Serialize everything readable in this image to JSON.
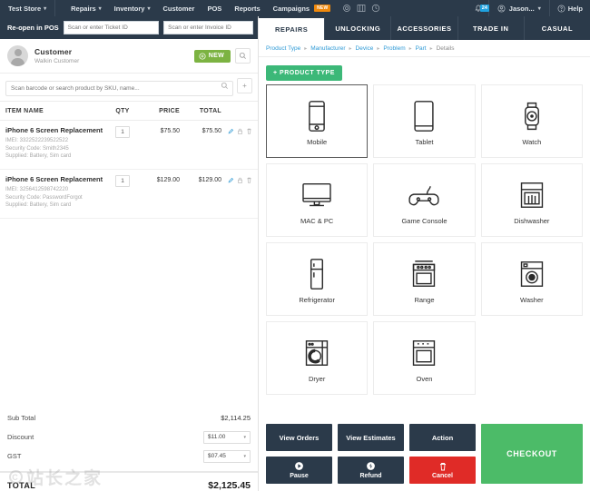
{
  "topnav": {
    "store": "Test Store",
    "items": [
      {
        "label": "Repairs",
        "caret": true,
        "badge": null
      },
      {
        "label": "Inventory",
        "caret": true,
        "badge": null
      },
      {
        "label": "Customer",
        "caret": false,
        "badge": null
      },
      {
        "label": "POS",
        "caret": false,
        "badge": null
      },
      {
        "label": "Reports",
        "caret": false,
        "badge": null
      },
      {
        "label": "Campaigns",
        "caret": false,
        "badge": "NEW"
      }
    ],
    "icons": [
      "gear-icon",
      "grid-icon",
      "power-icon"
    ],
    "notification_count": "24",
    "user": "Jason...",
    "help": "Help"
  },
  "left_panel": {
    "reopen": {
      "label": "Re-open in POS",
      "ticket_placeholder": "Scan or enter Ticket ID",
      "invoice_placeholder": "Scan or enter Invoice ID",
      "ticket_value": "",
      "invoice_value": ""
    },
    "customer": {
      "title": "Customer",
      "name": "Walkin Customer",
      "new_label": "NEW"
    },
    "scan": {
      "placeholder": "Scan barcode or search product by SKU, name...",
      "value": "",
      "plus": "+"
    },
    "table": {
      "headers": {
        "name": "ITEM NAME",
        "qty": "QTY",
        "price": "PRICE",
        "total": "TOTAL"
      },
      "rows": [
        {
          "name": "iPhone 6 Screen Replacement",
          "imei": "IMEI: 3322522239522522",
          "security": "Security Code: Smith2345",
          "supplied": "Supplied: Battery, Sim card",
          "qty": "1",
          "price": "$75.50",
          "total": "$75.50"
        },
        {
          "name": "iPhone 6 Screen Replacement",
          "imei": "IMEI: 3256412598742220",
          "security": "Security Code: PasswordForgot",
          "supplied": "Supplied: Battery, Sim card",
          "qty": "1",
          "price": "$129.00",
          "total": "$129.00"
        }
      ]
    },
    "totals": {
      "subtotal_label": "Sub Total",
      "subtotal_value": "$2,114.25",
      "discount_label": "Discount",
      "discount_value": "$11.00",
      "gst_label": "GST",
      "gst_value": "$07.45",
      "total_label": "TOTAL",
      "total_value": "$2,125.45"
    },
    "watermark": "站长之家"
  },
  "right_panel": {
    "tabs": [
      {
        "label": "REPAIRS",
        "active": true
      },
      {
        "label": "UNLOCKING",
        "active": false
      },
      {
        "label": "ACCESSORIES",
        "active": false
      },
      {
        "label": "TRADE IN",
        "active": false
      },
      {
        "label": "CASUAL",
        "active": false
      }
    ],
    "breadcrumb": [
      "Product Type",
      "Manufacturer",
      "Device",
      "Problem",
      "Part",
      "Details"
    ],
    "product_type_button": "+ PRODUCT TYPE",
    "cards": [
      {
        "label": "Mobile",
        "icon": "mobile-icon",
        "selected": true
      },
      {
        "label": "Tablet",
        "icon": "tablet-icon",
        "selected": false
      },
      {
        "label": "Watch",
        "icon": "watch-icon",
        "selected": false
      },
      {
        "label": "MAC & PC",
        "icon": "desktop-icon",
        "selected": false
      },
      {
        "label": "Game Console",
        "icon": "gamepad-icon",
        "selected": false
      },
      {
        "label": "Dishwasher",
        "icon": "dishwasher-icon",
        "selected": false
      },
      {
        "label": "Refrigerator",
        "icon": "refrigerator-icon",
        "selected": false
      },
      {
        "label": "Range",
        "icon": "range-icon",
        "selected": false
      },
      {
        "label": "Washer",
        "icon": "washer-icon",
        "selected": false
      },
      {
        "label": "Dryer",
        "icon": "dryer-icon",
        "selected": false
      },
      {
        "label": "Oven",
        "icon": "oven-icon",
        "selected": false
      }
    ],
    "actions": {
      "view_orders": "View Orders",
      "view_estimates": "View Estimates",
      "action": "Action",
      "pause": "Pause",
      "refund": "Refund",
      "cancel": "Cancel",
      "checkout": "CHECKOUT"
    }
  },
  "colors": {
    "navy": "#2b3a4a",
    "green_new": "#7cb342",
    "green_product": "#3cb878",
    "green_checkout": "#4cbb68",
    "red_cancel": "#e02b27",
    "link_blue": "#2f9ad6",
    "badge_orange": "#f0890c",
    "badge_blue": "#1fa2e0"
  }
}
